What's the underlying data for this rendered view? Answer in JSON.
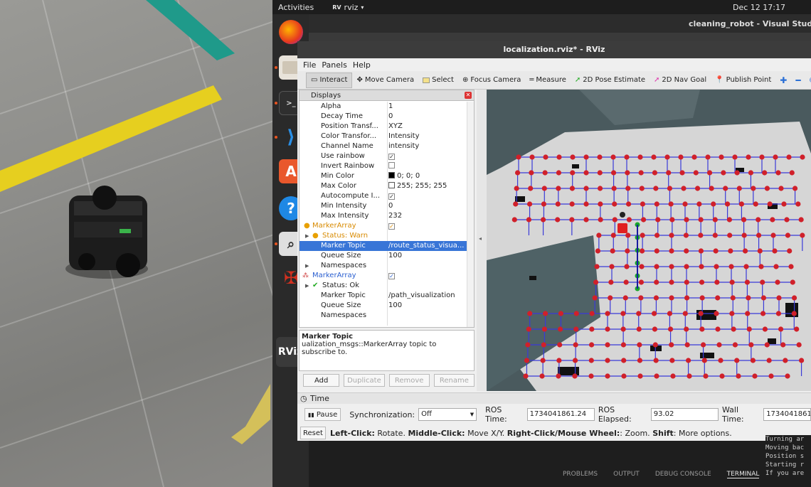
{
  "topbar": {
    "activities": "Activities",
    "app": "rviz",
    "clock": "Dec 12  17:17"
  },
  "vscode": {
    "title": "cleaning_robot - Visual Studio Co",
    "panel_tabs": [
      "PROBLEMS",
      "OUTPUT",
      "DEBUG CONSOLE",
      "TERMINAL"
    ],
    "terminal_lines": [
      "Turning ar",
      "Moving bac",
      "Position s",
      "Starting r",
      "If you are"
    ]
  },
  "rviz": {
    "title": "localization.rviz* - RViz",
    "menu": [
      "File",
      "Panels",
      "Help"
    ],
    "tools": [
      "Interact",
      "Move Camera",
      "Select",
      "Focus Camera",
      "Measure",
      "2D Pose Estimate",
      "2D Nav Goal",
      "Publish Point"
    ],
    "displays_title": "Displays",
    "props": [
      {
        "name": "Alpha",
        "value": "1"
      },
      {
        "name": "Decay Time",
        "value": "0"
      },
      {
        "name": "Position Transf...",
        "value": "XYZ"
      },
      {
        "name": "Color Transfor...",
        "value": "Intensity"
      },
      {
        "name": "Channel Name",
        "value": "intensity"
      },
      {
        "name": "Use rainbow",
        "value": "✓"
      },
      {
        "name": "Invert Rainbow",
        "value": ""
      },
      {
        "name": "Min Color",
        "value": "0; 0; 0"
      },
      {
        "name": "Max Color",
        "value": "255; 255; 255"
      },
      {
        "name": "Autocompute I...",
        "value": "✓"
      },
      {
        "name": "Min Intensity",
        "value": "0"
      },
      {
        "name": "Max Intensity",
        "value": "232"
      },
      {
        "name": "MarkerArray",
        "value": "✓"
      },
      {
        "name": "Status: Warn",
        "value": ""
      },
      {
        "name": "Marker Topic",
        "value": "/route_status_visua..."
      },
      {
        "name": "Queue Size",
        "value": "100"
      },
      {
        "name": "Namespaces",
        "value": ""
      },
      {
        "name": "MarkerArray",
        "value": "✓"
      },
      {
        "name": "Status: Ok",
        "value": ""
      },
      {
        "name": "Marker Topic",
        "value": "/path_visualization"
      },
      {
        "name": "Queue Size",
        "value": "100"
      },
      {
        "name": "Namespaces",
        "value": ""
      }
    ],
    "desc_title": "Marker Topic",
    "desc_text": "ualization_msgs::MarkerArray topic to subscribe to.",
    "buttons": [
      "Add",
      "Duplicate",
      "Remove",
      "Rename"
    ],
    "time": {
      "header": "Time",
      "pause": "Pause",
      "sync_label": "Synchronization:",
      "sync_value": "Off",
      "ros_time_label": "ROS Time:",
      "ros_time": "1734041861.24",
      "ros_elapsed_label": "ROS Elapsed:",
      "ros_elapsed": "93.02",
      "wall_time_label": "Wall Time:",
      "wall_time": "1734041861."
    },
    "status": {
      "reset": "Reset",
      "left": "Left-Click:",
      "left_t": " Rotate. ",
      "middle": "Middle-Click:",
      "middle_t": " Move X/Y. ",
      "right": "Right-Click/Mouse Wheel:",
      "right_t": ": Zoom. ",
      "shift": "Shift",
      "shift_t": ": More options."
    }
  },
  "dock_icon_text": "RViz",
  "colors": {
    "ros_red": "#d0202a",
    "route_blue": "#3a3ad8",
    "path_green": "#19a62a",
    "map_free": "#d6d6d6",
    "warn": "#e8a000"
  }
}
